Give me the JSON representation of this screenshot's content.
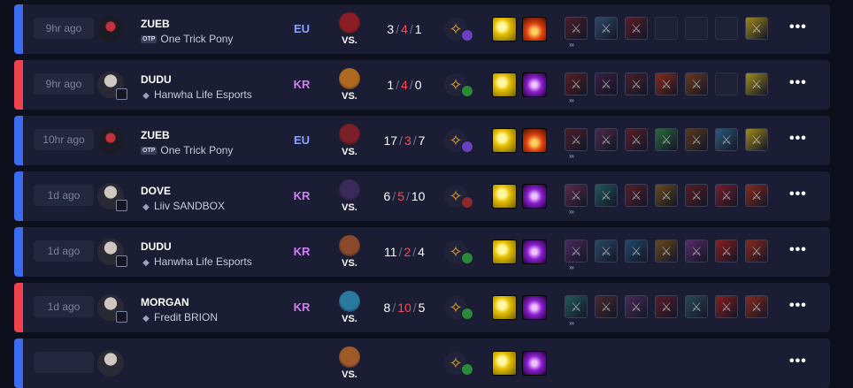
{
  "vs_label": "VS.",
  "more_icon": "•••",
  "item_glyph": "⚔",
  "chevron": "›››",
  "colors": {
    "win": "#3b6cf0",
    "loss": "#f0434f",
    "deaths": "#ff4a57",
    "region_eu": "#8aa4ff",
    "region_kr": "#d37ff5"
  },
  "matches": [
    {
      "result": "win",
      "time": "9hr ago",
      "player": "ZUEB",
      "team_prefix": "OTP",
      "team": "One Trick Pony",
      "region": "EU",
      "champion_color": "#8a1e24",
      "kills": "3",
      "deaths": "4",
      "assists": "1",
      "secondary_rune_color": "#6a3fc0",
      "spells": [
        "flash",
        "ignite"
      ],
      "items": [
        "#4a1f2a",
        "#2e4a66",
        "#5a1e28",
        "empty",
        "empty",
        "empty",
        "#a08a1a"
      ]
    },
    {
      "result": "loss",
      "time": "9hr ago",
      "player": "DUDU",
      "team_prefix": "",
      "team": "Hanwha Life Esports",
      "region": "KR",
      "champion_color": "#b06a20",
      "kills": "1",
      "deaths": "4",
      "assists": "0",
      "secondary_rune_color": "#2a8a3a",
      "spells": [
        "flash",
        "teleport"
      ],
      "items": [
        "#5a1e22",
        "#3a1e40",
        "#4a1e28",
        "#8a2a1a",
        "#6a3a1a",
        "empty",
        "#a08a1a"
      ]
    },
    {
      "result": "win",
      "time": "10hr ago",
      "player": "ZUEB",
      "team_prefix": "OTP",
      "team": "One Trick Pony",
      "region": "EU",
      "champion_color": "#7a1e28",
      "kills": "17",
      "deaths": "3",
      "assists": "7",
      "secondary_rune_color": "#6a3fc0",
      "spells": [
        "flash",
        "ignite"
      ],
      "items": [
        "#4a1f2a",
        "#4a2a4a",
        "#5a1e28",
        "#2a6a3a",
        "#5a3a1a",
        "#2a5a7a",
        "#a08a1a"
      ]
    },
    {
      "result": "win",
      "time": "1d ago",
      "player": "DOVE",
      "team_prefix": "",
      "team": "Liiv SANDBOX",
      "region": "KR",
      "champion_color": "#3a2a5a",
      "kills": "6",
      "deaths": "5",
      "assists": "10",
      "secondary_rune_color": "#8a2a2a",
      "spells": [
        "flash",
        "teleport"
      ],
      "items": [
        "#5a2a4a",
        "#1e5a5a",
        "#5a1e28",
        "#6a4a1a",
        "#5a1e22",
        "#7a1e2a",
        "#8a2a1a"
      ]
    },
    {
      "result": "win",
      "time": "1d ago",
      "player": "DUDU",
      "team_prefix": "",
      "team": "Hanwha Life Esports",
      "region": "KR",
      "champion_color": "#8a4a2a",
      "kills": "11",
      "deaths": "2",
      "assists": "4",
      "secondary_rune_color": "#2a8a3a",
      "spells": [
        "flash",
        "teleport"
      ],
      "items": [
        "#4a2a5a",
        "#2a4a66",
        "#1e4a6a",
        "#6a4a1a",
        "#5a2a6a",
        "#8a1e1e",
        "#8a2a1a"
      ]
    },
    {
      "result": "loss",
      "time": "1d ago",
      "player": "MORGAN",
      "team_prefix": "",
      "team": "Fredit BRION",
      "region": "KR",
      "champion_color": "#2a7aa0",
      "kills": "8",
      "deaths": "10",
      "assists": "5",
      "secondary_rune_color": "#2a8a3a",
      "spells": [
        "flash",
        "teleport"
      ],
      "items": [
        "#1e5a5a",
        "#4a2a2a",
        "#4a2a5a",
        "#5a1e28",
        "#2a4a5a",
        "#8a1e1e",
        "#8a2a1a"
      ]
    },
    {
      "result": "win",
      "time": "",
      "player": "",
      "team_prefix": "",
      "team": "",
      "region": "",
      "champion_color": "#a05a2a",
      "kills": "",
      "deaths": "",
      "assists": "",
      "secondary_rune_color": "#2a8a3a",
      "spells": [
        "flash",
        "teleport"
      ],
      "items": []
    }
  ]
}
